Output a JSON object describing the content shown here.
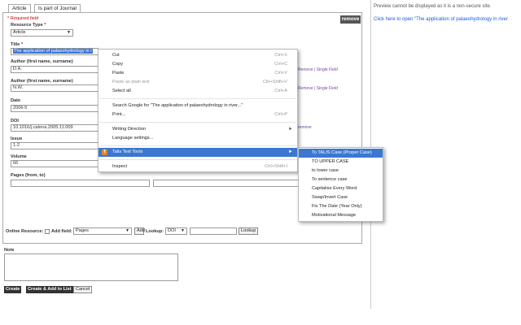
{
  "tabs": [
    {
      "label": "Article"
    },
    {
      "label": "Is part of Journal"
    }
  ],
  "form": {
    "required_note": "* Required field",
    "remove_label": "remove",
    "resource_type": {
      "label": "Resource Type",
      "star": "*",
      "value": "Article"
    },
    "title": {
      "label": "Title",
      "star": "*",
      "value": "The application of palaeohydrology in r"
    },
    "author1": {
      "label": "Author (first name, surname)",
      "value": "D.A."
    },
    "author2": {
      "label": "Author (first name, surname)",
      "value": "N.W."
    },
    "author_links": {
      "remove": "Remove",
      "sep": "|",
      "single": "Single Field"
    },
    "date": {
      "label": "Date",
      "value": "2006-5"
    },
    "doi": {
      "label": "DOI",
      "value": "10.1016/j.catena.2005.11.009",
      "remove": "remove"
    },
    "issue": {
      "label": "Issue",
      "value": "1-2"
    },
    "volume": {
      "label": "Volume",
      "value": "66"
    },
    "pages": {
      "label": "Pages (from, to)"
    },
    "online_resource": "Online Resource:",
    "add_field": "Add field:",
    "add_field_value": "Pages",
    "add_button": "Add",
    "lookup_label": "Lookup:",
    "lookup_value": "DOI",
    "lookup_button": "Lookup",
    "note_label": "Note",
    "create": "Create",
    "create_add": "Create & Add to List",
    "cancel": "Cancel"
  },
  "preview": {
    "message": "Preview cannot be displayed as it is a non-secure site.",
    "open_link": "Click here to open \"The application of palaeohydrology in river"
  },
  "context_menu": {
    "items": [
      {
        "label": "Cut",
        "shortcut": "Ctrl+X"
      },
      {
        "label": "Copy",
        "shortcut": "Ctrl+C"
      },
      {
        "label": "Paste",
        "shortcut": "Ctrl+V"
      },
      {
        "label": "Paste as plain text",
        "shortcut": "Ctrl+Shift+V"
      },
      {
        "label": "Select all",
        "shortcut": "Ctrl+A"
      },
      {
        "label": "Search Google for \"The application of palaeohydrology in river...\""
      },
      {
        "label": "Print...",
        "shortcut": "Ctrl+P"
      },
      {
        "label": "Writing Direction",
        "submenu": "►"
      },
      {
        "label": "Language settings..."
      },
      {
        "label": "Talis Text Tools",
        "submenu": "►",
        "icon": "T"
      },
      {
        "label": "Inspect",
        "shortcut": "Ctrl+Shift+I"
      }
    ]
  },
  "submenu": {
    "items": [
      {
        "label": "To TALIS Case (Proper Case)"
      },
      {
        "label": "TO UPPER CASE"
      },
      {
        "label": "to lower case"
      },
      {
        "label": "To sentence case"
      },
      {
        "label": "Capitalise Every Word"
      },
      {
        "label": "Swap/Invert Case"
      },
      {
        "label": "Fix The Date (Year Only)"
      },
      {
        "label": "Motivational Message"
      }
    ]
  },
  "colors": {
    "highlight": "#3b78d0",
    "link": "#1a5bd8",
    "required": "#cc0000"
  }
}
